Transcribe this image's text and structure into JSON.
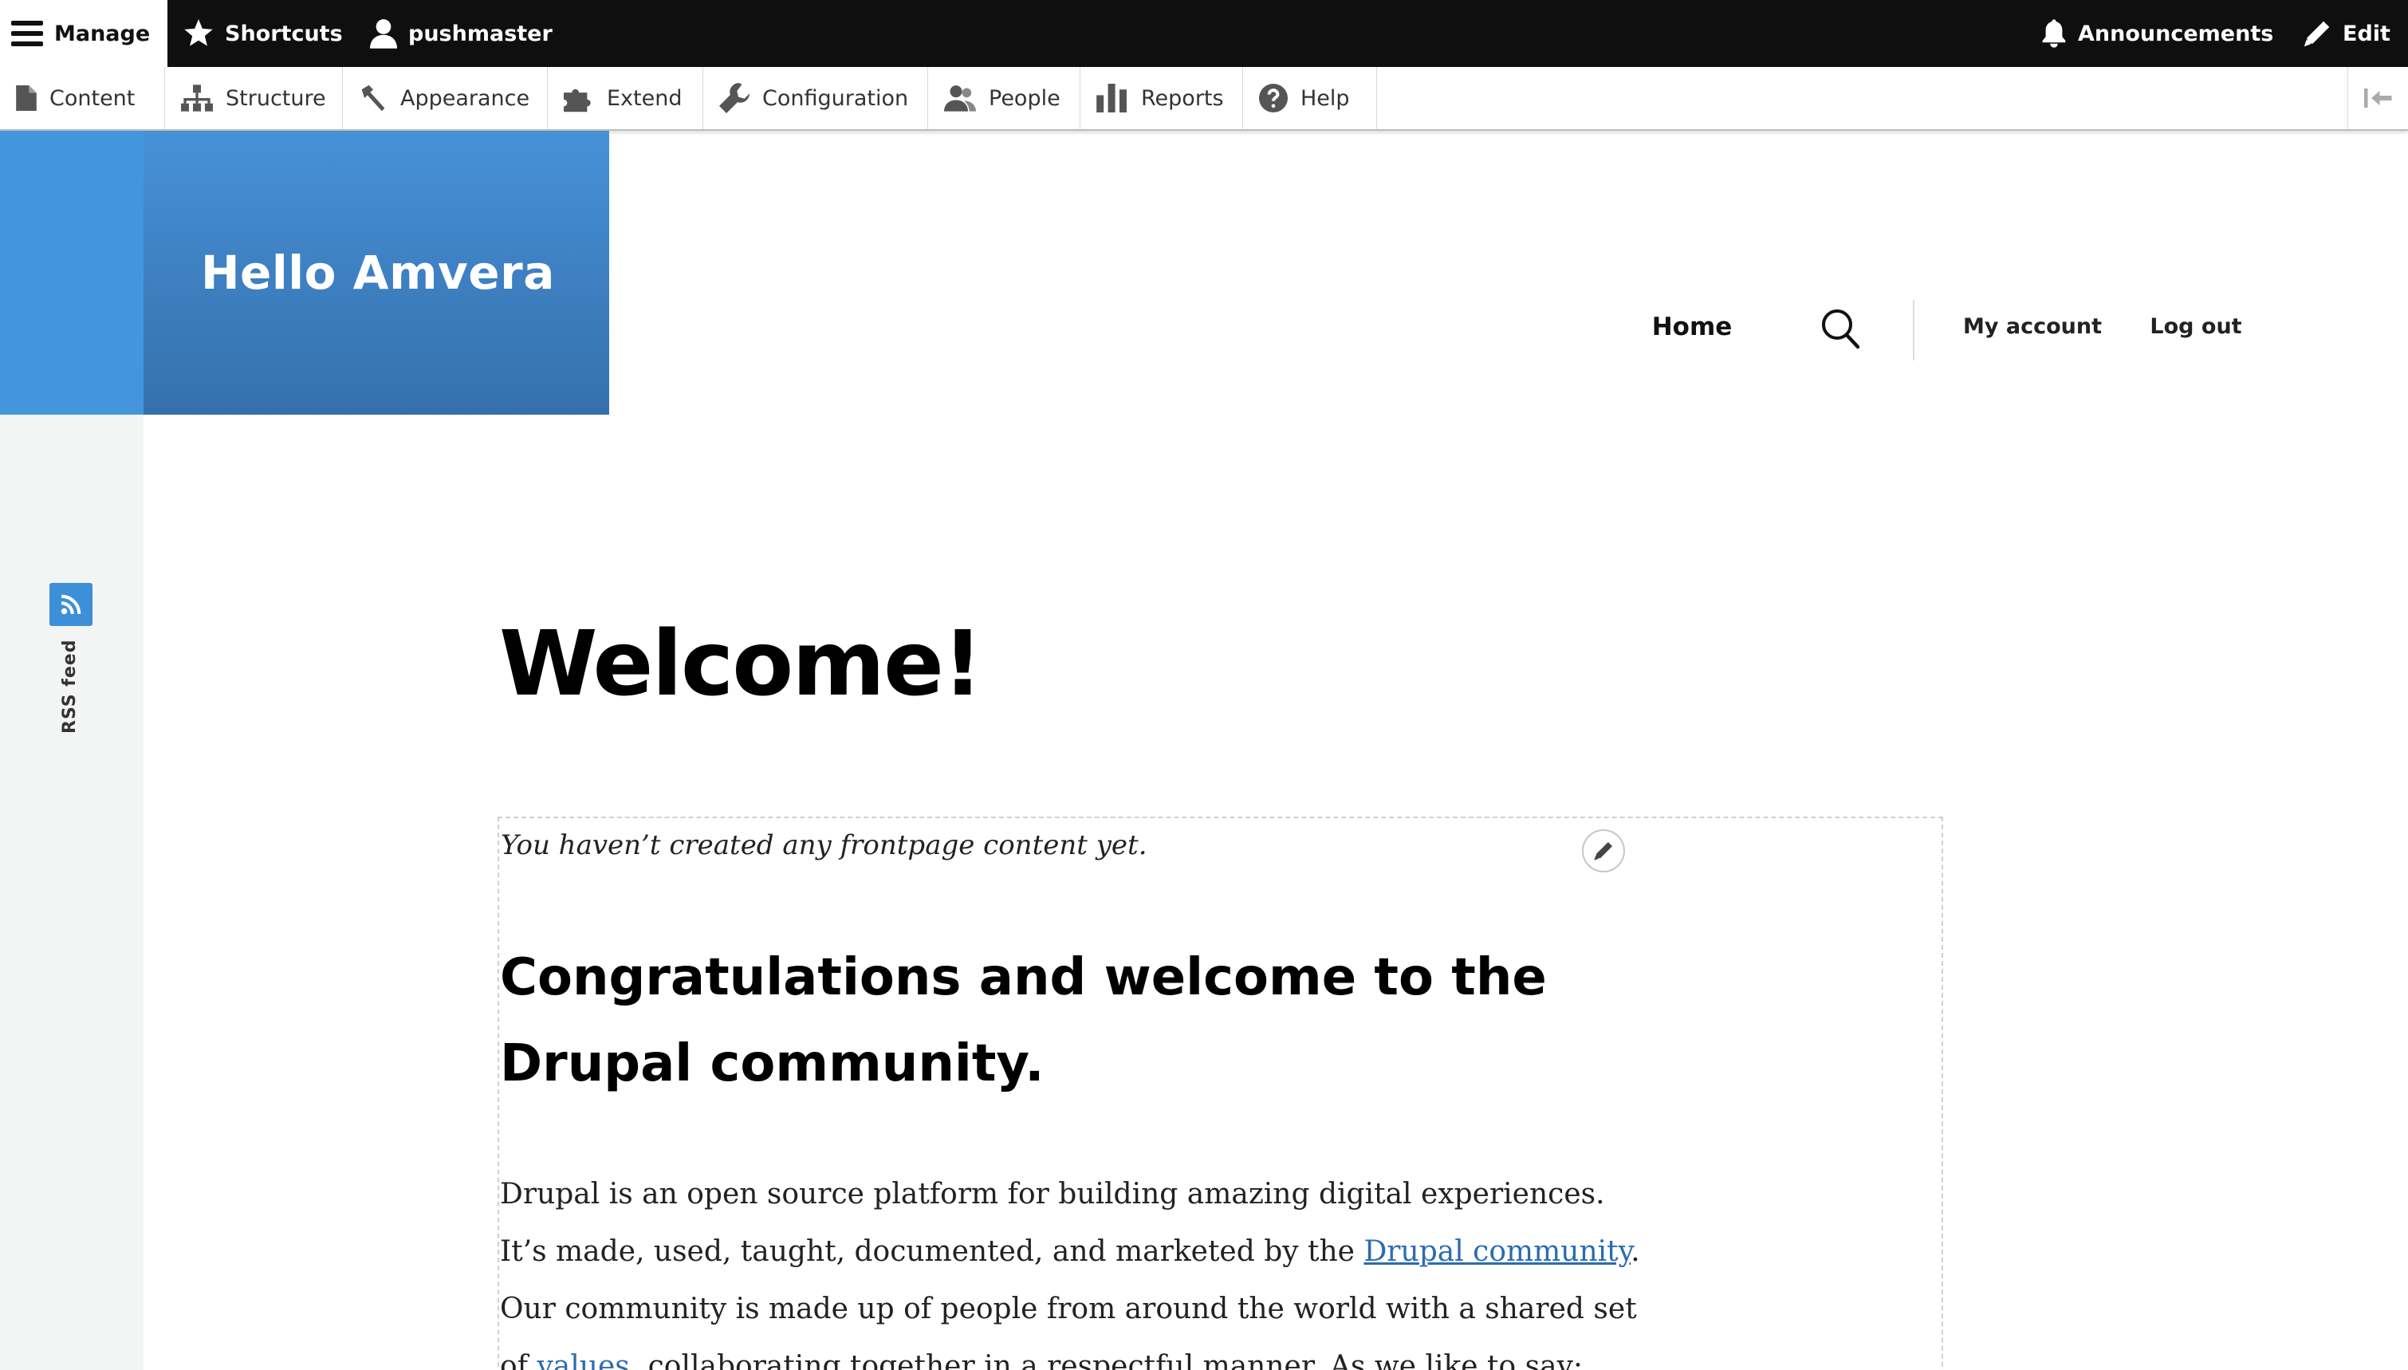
{
  "toolbar": {
    "manage_label": "Manage",
    "shortcuts_label": "Shortcuts",
    "user_label": "pushmaster",
    "announcements_label": "Announcements",
    "edit_label": "Edit"
  },
  "tray": {
    "items": [
      {
        "label": "Content",
        "icon": "file-icon"
      },
      {
        "label": "Structure",
        "icon": "sitemap-icon"
      },
      {
        "label": "Appearance",
        "icon": "hammer-icon"
      },
      {
        "label": "Extend",
        "icon": "puzzle-icon"
      },
      {
        "label": "Configuration",
        "icon": "wrench-icon"
      },
      {
        "label": "People",
        "icon": "people-icon"
      },
      {
        "label": "Reports",
        "icon": "bar-chart-icon"
      },
      {
        "label": "Help",
        "icon": "question-icon"
      }
    ]
  },
  "site": {
    "name": "Hello Amvera",
    "brand_color": "#3d84c6"
  },
  "nav": {
    "home": "Home",
    "my_account": "My account",
    "log_out": "Log out"
  },
  "sidebar": {
    "rss_label": "RSS feed"
  },
  "main": {
    "title": "Welcome!",
    "empty_message": "You haven’t created any frontpage content yet.",
    "heading": "Congratulations and welcome to the Drupal community.",
    "intro_part1": "Drupal is an open source platform for building amazing digital experiences. It’s made, used, taught, documented, and marketed by the ",
    "link_community": "Drupal community",
    "intro_part2": ". Our com­munity is made up of people from around the world with a shared set of ",
    "link_values": "values",
    "intro_part3": ", col­laborating together in a respectful manner. As we like to say:"
  }
}
